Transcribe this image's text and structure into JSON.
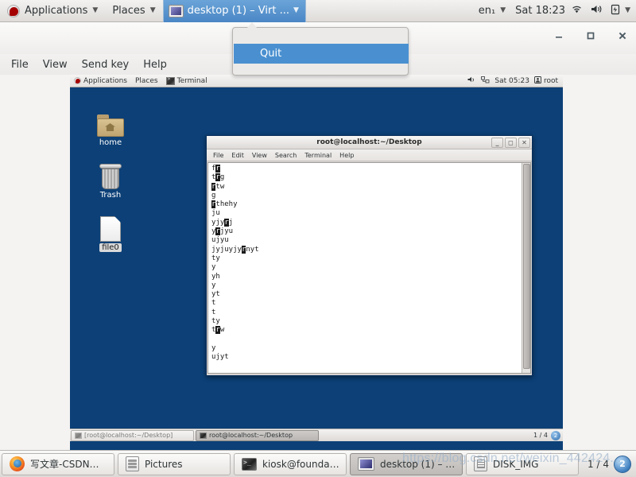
{
  "host_topbar": {
    "logo_icon": "fedora-logo-icon",
    "applications_label": "Applications",
    "places_label": "Places",
    "vm_tab_label": "desktop (1) – Virt ...",
    "vm_tab_icon": "monitor-icon",
    "caret_icon": "chevron-down-icon",
    "keyboard_layout": "en₁",
    "clock": "Sat 18:23",
    "wifi_icon": "wifi-icon",
    "volume_icon": "volume-icon",
    "battery_icon": "battery-icon"
  },
  "vm_window": {
    "menu": [
      "File",
      "View",
      "Send key",
      "Help"
    ],
    "window_buttons": {
      "minimize": "–",
      "maximize": "□",
      "close": "✕"
    }
  },
  "quit_popup": {
    "item_label": "Quit"
  },
  "guest": {
    "panel": {
      "applications_label": "Applications",
      "places_label": "Places",
      "terminal_label": "Terminal",
      "terminal_icon": "terminal-icon",
      "volume_icon": "volume-icon",
      "network_icon": "network-icon",
      "clock": "Sat 05:23",
      "user_icon": "user-icon",
      "user_label": "root"
    },
    "desktop_icons": [
      {
        "name": "home",
        "label": "home",
        "icon": "folder-icon",
        "selected": false
      },
      {
        "name": "trash",
        "label": "Trash",
        "icon": "trash-icon",
        "selected": false
      },
      {
        "name": "file0",
        "label": "file0",
        "icon": "document-icon",
        "selected": true
      }
    ],
    "terminal": {
      "title": "root@localhost:~/Desktop",
      "menu": [
        "File",
        "Edit",
        "View",
        "Search",
        "Terminal",
        "Help"
      ],
      "window_buttons": {
        "minimize": "–",
        "maximize": "□",
        "close": "✕"
      },
      "lines": [
        [
          {
            "t": "f",
            "hl": false
          },
          {
            "t": "r",
            "hl": true
          }
        ],
        [
          {
            "t": "t",
            "hl": false
          },
          {
            "t": "r",
            "hl": true
          },
          {
            "t": "g",
            "hl": false
          }
        ],
        [
          {
            "t": "r",
            "hl": true
          },
          {
            "t": "tw",
            "hl": false
          }
        ],
        [
          {
            "t": "g",
            "hl": false
          }
        ],
        [
          {
            "t": "r",
            "hl": true
          },
          {
            "t": "thehy",
            "hl": false
          }
        ],
        [
          {
            "t": "ju",
            "hl": false
          }
        ],
        [
          {
            "t": "yjy",
            "hl": false
          },
          {
            "t": "r",
            "hl": true
          },
          {
            "t": "j",
            "hl": false
          }
        ],
        [
          {
            "t": "y",
            "hl": false
          },
          {
            "t": "r",
            "hl": true
          },
          {
            "t": "jyu",
            "hl": false
          }
        ],
        [
          {
            "t": "ujyu",
            "hl": false
          }
        ],
        [
          {
            "t": "jyjuyjy",
            "hl": false
          },
          {
            "t": "r",
            "hl": true
          },
          {
            "t": "nyt",
            "hl": false
          }
        ],
        [
          {
            "t": "ty",
            "hl": false
          }
        ],
        [
          {
            "t": "y",
            "hl": false
          }
        ],
        [
          {
            "t": "yh",
            "hl": false
          }
        ],
        [
          {
            "t": "y",
            "hl": false
          }
        ],
        [
          {
            "t": "yt",
            "hl": false
          }
        ],
        [
          {
            "t": "t",
            "hl": false
          }
        ],
        [
          {
            "t": "t",
            "hl": false
          }
        ],
        [
          {
            "t": "ty",
            "hl": false
          }
        ],
        [
          {
            "t": "t",
            "hl": false
          },
          {
            "t": "r",
            "hl": true
          },
          {
            "t": "w",
            "hl": false
          }
        ],
        [],
        [
          {
            "t": "y",
            "hl": false
          }
        ],
        [
          {
            "t": "ujyt",
            "hl": false
          }
        ],
        [],
        [
          {
            "t": ":",
            "hl": false
          }
        ]
      ]
    },
    "taskbar": {
      "tasks": [
        {
          "label": "[root@localhost:~/Desktop]",
          "active": false
        },
        {
          "label": "root@localhost:~/Desktop",
          "active": true
        }
      ],
      "workspace": "1 / 4",
      "workspace_badge": "2"
    }
  },
  "host_taskbar": {
    "tasks": [
      {
        "label": "写文章-CSDN…",
        "icon": "firefox-icon",
        "active": false
      },
      {
        "label": "Pictures",
        "icon": "file-manager-icon",
        "active": false
      },
      {
        "label": "kiosk@founda…",
        "icon": "terminal-icon",
        "active": false
      },
      {
        "label": "desktop (1) – …",
        "icon": "monitor-icon",
        "active": true
      },
      {
        "label": "DISK_IMG",
        "icon": "disk-icon",
        "active": false
      }
    ],
    "workspace": "1 / 4",
    "workspace_badge": "2"
  },
  "watermark": {
    "text": "https://blog.csdn.net/weixin_442424..."
  }
}
